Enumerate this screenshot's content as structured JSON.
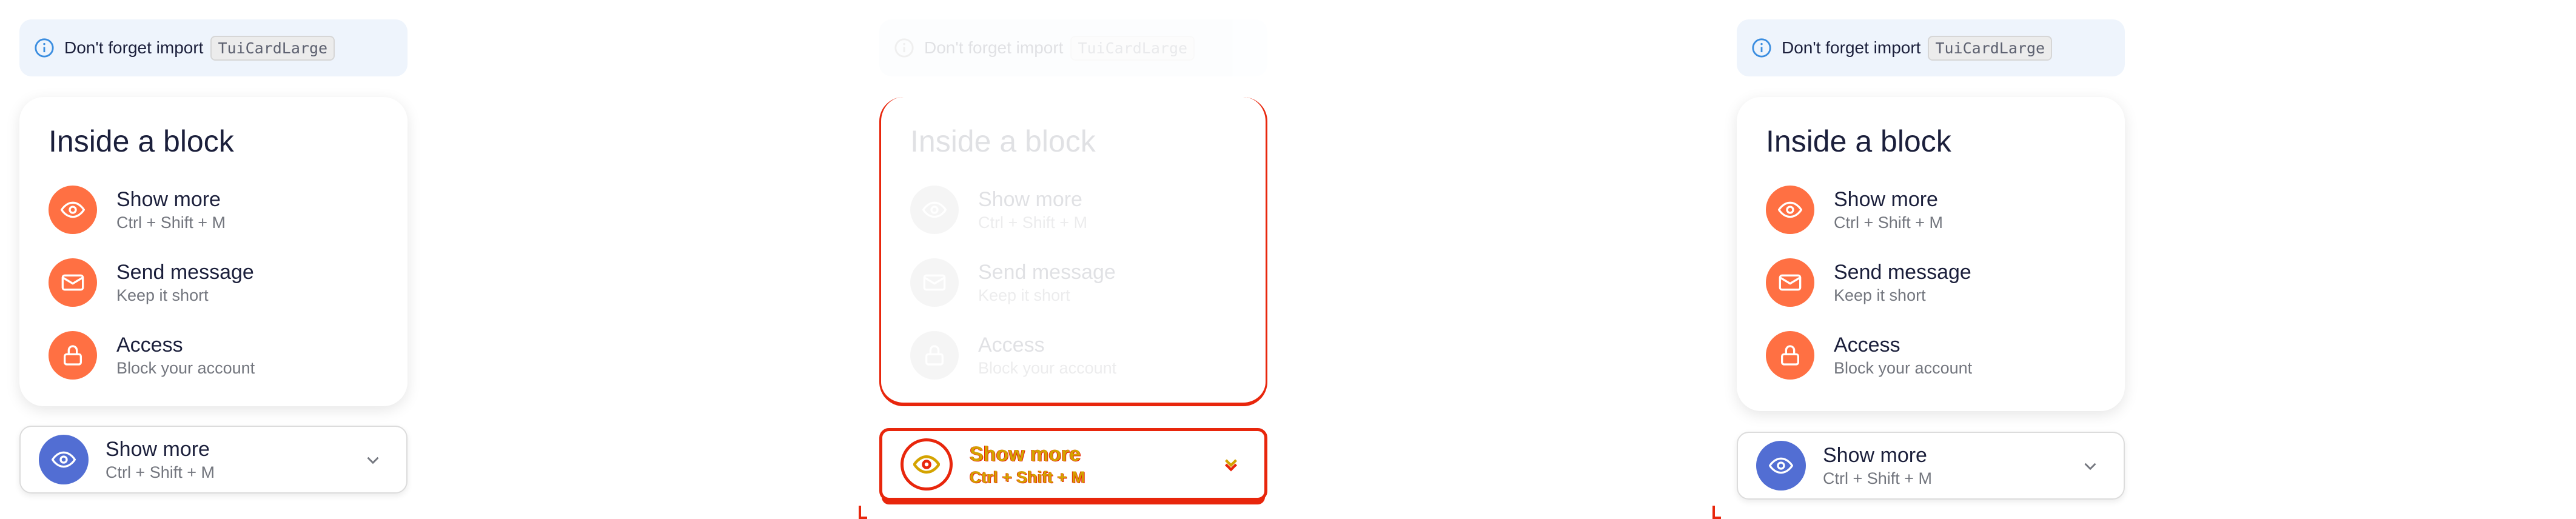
{
  "notice": {
    "text": "Don't forget import",
    "code": "TuiCardLarge"
  },
  "card": {
    "title": "Inside a block",
    "items": [
      {
        "title": "Show more",
        "subtitle": "Ctrl + Shift + M",
        "icon": "eye-icon"
      },
      {
        "title": "Send message",
        "subtitle": "Keep it short",
        "icon": "mail-icon"
      },
      {
        "title": "Access",
        "subtitle": "Block your account",
        "icon": "lock-icon"
      }
    ]
  },
  "select": {
    "title": "Show more",
    "subtitle": "Ctrl + Shift + M",
    "icon": "eye-icon"
  },
  "colors": {
    "accent": "#ff7043",
    "select_accent": "#526ed3",
    "notice_bg": "#eef4fc",
    "error_outline": "#e8260c"
  }
}
